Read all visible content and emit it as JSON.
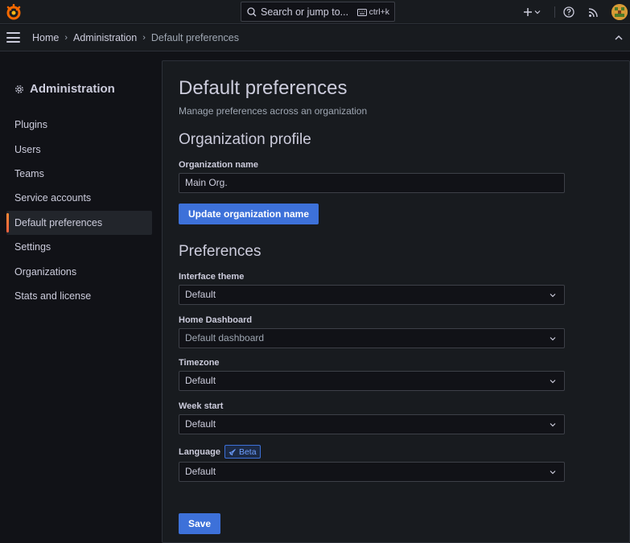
{
  "topbar": {
    "search_placeholder": "Search or jump to...",
    "search_shortcut": "ctrl+k"
  },
  "breadcrumb": {
    "items": [
      "Home",
      "Administration",
      "Default preferences"
    ]
  },
  "sidenav": {
    "title": "Administration",
    "items": [
      {
        "label": "Plugins"
      },
      {
        "label": "Users"
      },
      {
        "label": "Teams"
      },
      {
        "label": "Service accounts"
      },
      {
        "label": "Default preferences",
        "active": true
      },
      {
        "label": "Settings"
      },
      {
        "label": "Organizations"
      },
      {
        "label": "Stats and license"
      }
    ]
  },
  "page": {
    "title": "Default preferences",
    "subtitle": "Manage preferences across an organization",
    "org_profile": {
      "heading": "Organization profile",
      "name_label": "Organization name",
      "name_value": "Main Org.",
      "update_button": "Update organization name"
    },
    "preferences": {
      "heading": "Preferences",
      "theme_label": "Interface theme",
      "theme_value": "Default",
      "home_label": "Home Dashboard",
      "home_value": "Default dashboard",
      "timezone_label": "Timezone",
      "timezone_value": "Default",
      "week_label": "Week start",
      "week_value": "Default",
      "language_label": "Language",
      "language_badge": "Beta",
      "language_value": "Default",
      "save_button": "Save"
    }
  },
  "colors": {
    "primary": "#3d71d9",
    "active_accent": "#ff8833",
    "background": "#111217",
    "panel": "#181b1f"
  }
}
